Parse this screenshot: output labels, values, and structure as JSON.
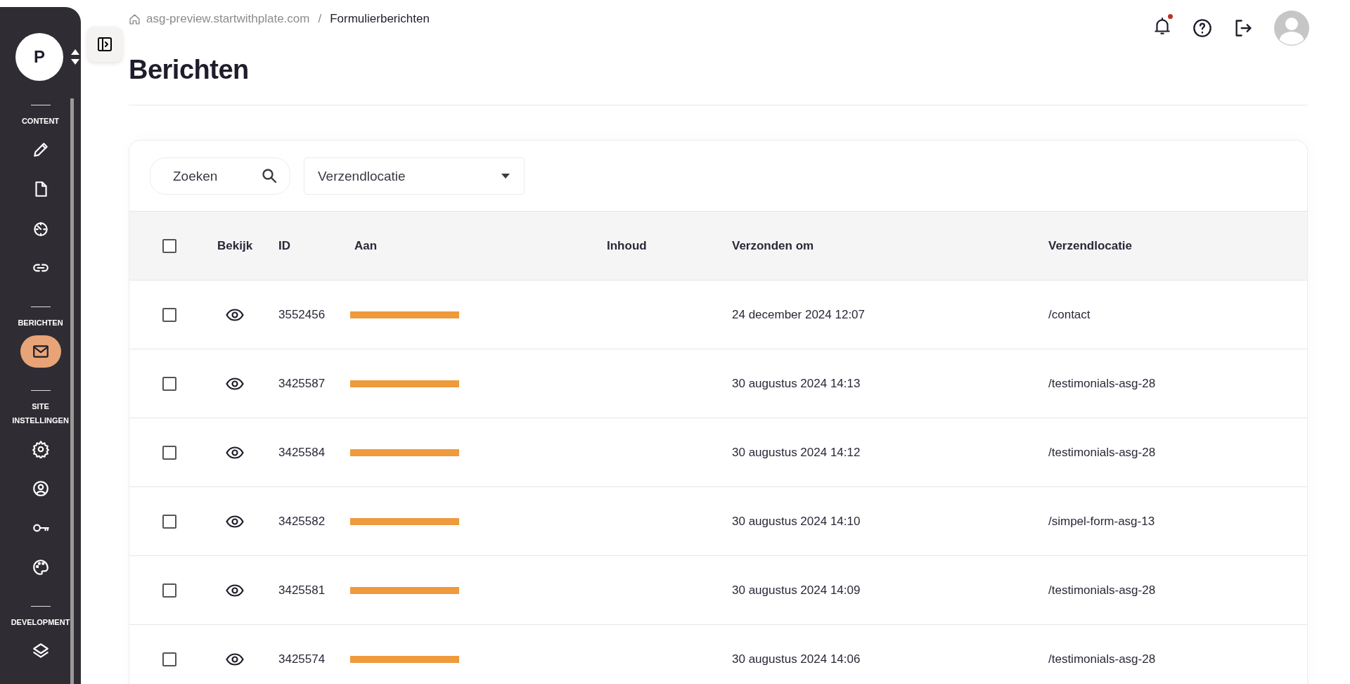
{
  "sidebar": {
    "account_initial": "P",
    "sections": [
      {
        "label": "CONTENT",
        "items": [
          {
            "kind": "pencil",
            "selected": false
          },
          {
            "kind": "file",
            "selected": false
          },
          {
            "kind": "timer",
            "selected": false
          },
          {
            "kind": "link",
            "selected": false
          }
        ]
      },
      {
        "label": "BERICHTEN",
        "items": [
          {
            "kind": "mail",
            "selected": true
          }
        ]
      },
      {
        "label": "SITE INSTELLINGEN",
        "items": [
          {
            "kind": "gear",
            "selected": false
          },
          {
            "kind": "user",
            "selected": false
          },
          {
            "kind": "key",
            "selected": false
          },
          {
            "kind": "palette",
            "selected": false
          }
        ]
      },
      {
        "label": "DEVELOPMENT",
        "items": [
          {
            "kind": "layers",
            "selected": false
          }
        ]
      }
    ]
  },
  "breadcrumb": {
    "parent": "asg-preview.startwithplate.com",
    "separator": "/",
    "current": "Formulierberichten"
  },
  "header": {
    "notifications_unread": true
  },
  "page_title": "Berichten",
  "filters": {
    "search": {
      "placeholder": "Zoeken"
    },
    "dropdown": {
      "label": "Verzendlocatie"
    }
  },
  "table": {
    "select_all_checked": false,
    "columns": [
      "Bekijk",
      "ID",
      "Aan",
      "Inhoud",
      "Verzonden om",
      "Verzendlocatie"
    ],
    "rows": [
      {
        "checked": false,
        "id": "3552456",
        "aan": {
          "kind": "redacted"
        },
        "verzonden_om": "24 december 2024 12:07",
        "verzendlocatie": "/contact"
      },
      {
        "checked": false,
        "id": "3425587",
        "aan": {
          "kind": "redacted"
        },
        "verzonden_om": "30 augustus 2024 14:13",
        "verzendlocatie": "/testimonials-asg-28"
      },
      {
        "checked": false,
        "id": "3425584",
        "aan": {
          "kind": "redacted"
        },
        "verzonden_om": "30 augustus 2024 14:12",
        "verzendlocatie": "/testimonials-asg-28"
      },
      {
        "checked": false,
        "id": "3425582",
        "aan": {
          "kind": "redacted"
        },
        "verzonden_om": "30 augustus 2024 14:10",
        "verzendlocatie": "/simpel-form-asg-13"
      },
      {
        "checked": false,
        "id": "3425581",
        "aan": {
          "kind": "redacted"
        },
        "verzonden_om": "30 augustus 2024 14:09",
        "verzendlocatie": "/testimonials-asg-28"
      },
      {
        "checked": false,
        "id": "3425574",
        "aan": {
          "kind": "redacted"
        },
        "verzonden_om": "30 augustus 2024 14:06",
        "verzendlocatie": "/testimonials-asg-28"
      }
    ]
  }
}
